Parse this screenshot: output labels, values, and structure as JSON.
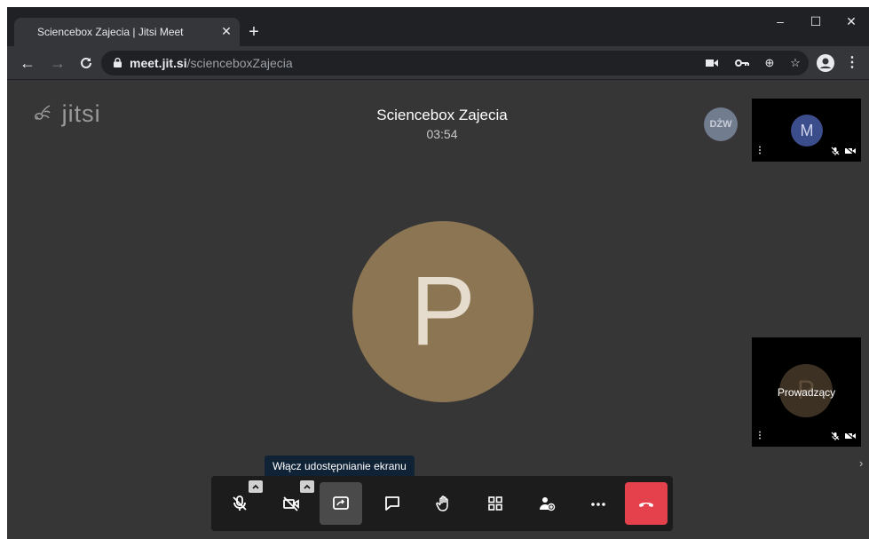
{
  "browser": {
    "tab_title": "Sciencebox Zajecia | Jitsi Meet",
    "new_tab": "+",
    "url_host": "meet.jit.si",
    "url_path": "/scienceboxZajecia"
  },
  "window_controls": {
    "minimize": "–",
    "maximize": "☐",
    "close": "✕"
  },
  "meeting": {
    "logo_text": "jitsi",
    "conference_name": "Sciencebox Zajecia",
    "timer": "03:54",
    "large_video_initial": "P",
    "participant_badge": "DŻW",
    "colors": {
      "large_avatar": "#8c7553",
      "hangup": "#e5414d",
      "thumb_m_avatar": "#3b4d8a"
    }
  },
  "thumbnails": [
    {
      "initial": "M",
      "name": ""
    },
    {
      "initial": "P",
      "name": "Prowadzący"
    }
  ],
  "tooltip": {
    "text": "Włącz udostępnianie ekranu"
  },
  "toolbar_icons": [
    "microphone-muted-icon",
    "camera-off-icon",
    "screen-share-icon",
    "chat-icon",
    "raise-hand-icon",
    "tile-view-icon",
    "invite-icon",
    "more-icon",
    "hangup-icon"
  ]
}
